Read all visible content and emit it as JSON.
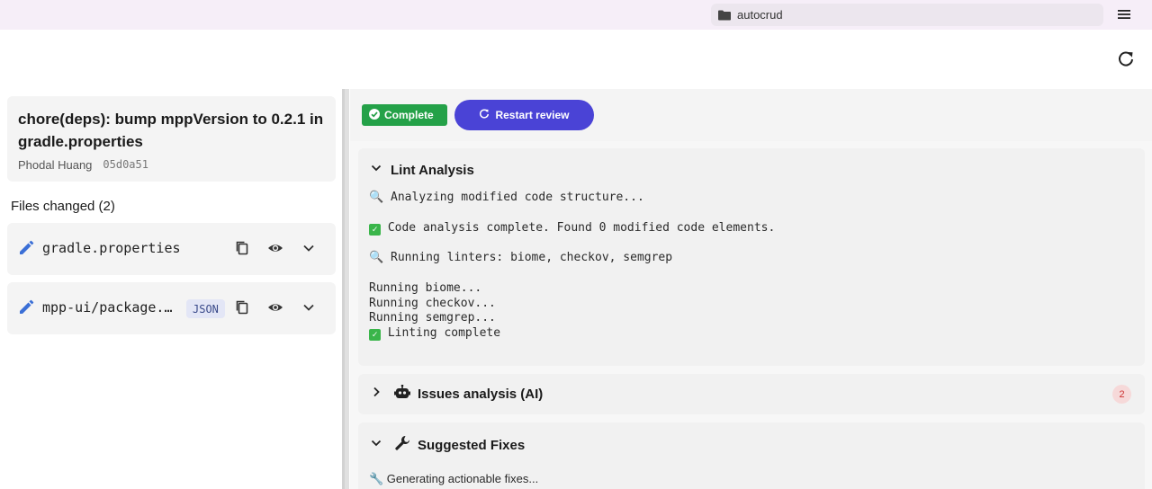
{
  "topbar": {
    "repo_name": "autocrud",
    "folder_icon": "folder-icon",
    "menu_icon": "hamburger-menu-icon"
  },
  "refresh_icon": "refresh-icon",
  "commit": {
    "title": "chore(deps): bump mppVersion to 0.2.1 in gradle.properties",
    "author": "Phodal Huang",
    "hash": "05d0a51"
  },
  "files": {
    "header": "Files changed (2)",
    "items": [
      {
        "name": "gradle.properties",
        "tag": ""
      },
      {
        "name": "mpp-ui/package.…",
        "tag": "JSON"
      }
    ]
  },
  "review": {
    "status_label": "Complete",
    "restart_label": "Restart review",
    "status_color": "#24a148",
    "accent_color": "#4a43d6"
  },
  "sections": {
    "lint": {
      "title": "Lint Analysis",
      "lines": [
        "🔍 Analyzing modified code structure...",
        "Code analysis complete. Found 0 modified code elements.",
        "🔍 Running linters: biome, checkov, semgrep",
        "Running biome...",
        "Running checkov...",
        "Running semgrep...",
        "Linting complete"
      ]
    },
    "issues": {
      "title": "Issues analysis (AI)",
      "count": "2"
    },
    "fixes": {
      "title": "Suggested Fixes",
      "line": "🔧 Generating actionable fixes..."
    }
  }
}
